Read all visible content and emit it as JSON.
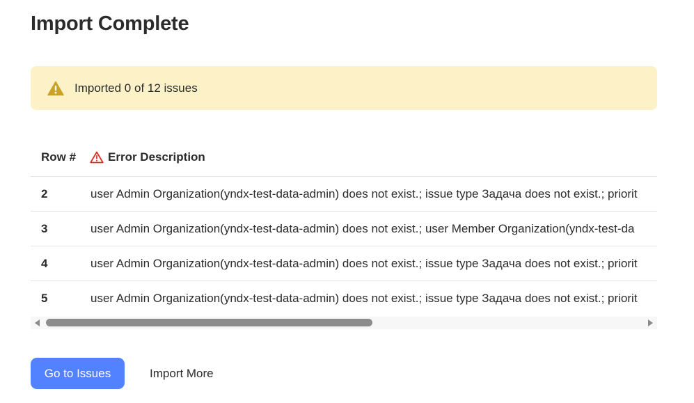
{
  "page": {
    "title": "Import Complete"
  },
  "alert": {
    "icon": "warning-triangle-icon",
    "text": "Imported 0 of 12 issues",
    "background": "#fdf1c8",
    "icon_color": "#c9a227"
  },
  "table": {
    "headers": {
      "row": "Row #",
      "error": "Error Description",
      "error_icon": "warning-outline-icon",
      "error_icon_color": "#d93025"
    },
    "rows": [
      {
        "num": "2",
        "desc": "user Admin Organization(yndx-test-data-admin) does not exist.; issue type Задача does not exist.; priorit"
      },
      {
        "num": "3",
        "desc": "user Admin Organization(yndx-test-data-admin) does not exist.; user Member Organization(yndx-test-da"
      },
      {
        "num": "4",
        "desc": "user Admin Organization(yndx-test-data-admin) does not exist.; issue type Задача does not exist.; priorit"
      },
      {
        "num": "5",
        "desc": "user Admin Organization(yndx-test-data-admin) does not exist.; issue type Задача does not exist.; priorit"
      }
    ]
  },
  "actions": {
    "primary_label": "Go to Issues",
    "secondary_label": "Import More",
    "primary_color": "#5282ff"
  }
}
